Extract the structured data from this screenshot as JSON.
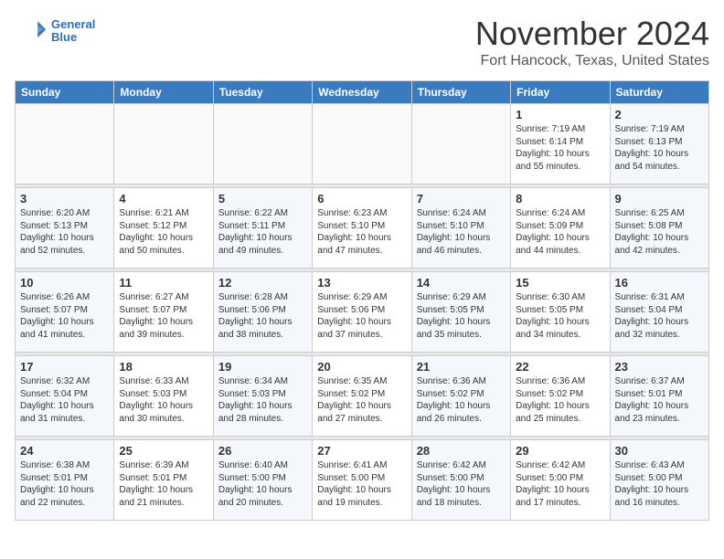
{
  "header": {
    "logo_line1": "General",
    "logo_line2": "Blue",
    "month": "November 2024",
    "location": "Fort Hancock, Texas, United States"
  },
  "weekdays": [
    "Sunday",
    "Monday",
    "Tuesday",
    "Wednesday",
    "Thursday",
    "Friday",
    "Saturday"
  ],
  "weeks": [
    [
      {
        "day": "",
        "text": ""
      },
      {
        "day": "",
        "text": ""
      },
      {
        "day": "",
        "text": ""
      },
      {
        "day": "",
        "text": ""
      },
      {
        "day": "",
        "text": ""
      },
      {
        "day": "1",
        "text": "Sunrise: 7:19 AM\nSunset: 6:14 PM\nDaylight: 10 hours and 55 minutes."
      },
      {
        "day": "2",
        "text": "Sunrise: 7:19 AM\nSunset: 6:13 PM\nDaylight: 10 hours and 54 minutes."
      }
    ],
    [
      {
        "day": "3",
        "text": "Sunrise: 6:20 AM\nSunset: 5:13 PM\nDaylight: 10 hours and 52 minutes."
      },
      {
        "day": "4",
        "text": "Sunrise: 6:21 AM\nSunset: 5:12 PM\nDaylight: 10 hours and 50 minutes."
      },
      {
        "day": "5",
        "text": "Sunrise: 6:22 AM\nSunset: 5:11 PM\nDaylight: 10 hours and 49 minutes."
      },
      {
        "day": "6",
        "text": "Sunrise: 6:23 AM\nSunset: 5:10 PM\nDaylight: 10 hours and 47 minutes."
      },
      {
        "day": "7",
        "text": "Sunrise: 6:24 AM\nSunset: 5:10 PM\nDaylight: 10 hours and 46 minutes."
      },
      {
        "day": "8",
        "text": "Sunrise: 6:24 AM\nSunset: 5:09 PM\nDaylight: 10 hours and 44 minutes."
      },
      {
        "day": "9",
        "text": "Sunrise: 6:25 AM\nSunset: 5:08 PM\nDaylight: 10 hours and 42 minutes."
      }
    ],
    [
      {
        "day": "10",
        "text": "Sunrise: 6:26 AM\nSunset: 5:07 PM\nDaylight: 10 hours and 41 minutes."
      },
      {
        "day": "11",
        "text": "Sunrise: 6:27 AM\nSunset: 5:07 PM\nDaylight: 10 hours and 39 minutes."
      },
      {
        "day": "12",
        "text": "Sunrise: 6:28 AM\nSunset: 5:06 PM\nDaylight: 10 hours and 38 minutes."
      },
      {
        "day": "13",
        "text": "Sunrise: 6:29 AM\nSunset: 5:06 PM\nDaylight: 10 hours and 37 minutes."
      },
      {
        "day": "14",
        "text": "Sunrise: 6:29 AM\nSunset: 5:05 PM\nDaylight: 10 hours and 35 minutes."
      },
      {
        "day": "15",
        "text": "Sunrise: 6:30 AM\nSunset: 5:05 PM\nDaylight: 10 hours and 34 minutes."
      },
      {
        "day": "16",
        "text": "Sunrise: 6:31 AM\nSunset: 5:04 PM\nDaylight: 10 hours and 32 minutes."
      }
    ],
    [
      {
        "day": "17",
        "text": "Sunrise: 6:32 AM\nSunset: 5:04 PM\nDaylight: 10 hours and 31 minutes."
      },
      {
        "day": "18",
        "text": "Sunrise: 6:33 AM\nSunset: 5:03 PM\nDaylight: 10 hours and 30 minutes."
      },
      {
        "day": "19",
        "text": "Sunrise: 6:34 AM\nSunset: 5:03 PM\nDaylight: 10 hours and 28 minutes."
      },
      {
        "day": "20",
        "text": "Sunrise: 6:35 AM\nSunset: 5:02 PM\nDaylight: 10 hours and 27 minutes."
      },
      {
        "day": "21",
        "text": "Sunrise: 6:36 AM\nSunset: 5:02 PM\nDaylight: 10 hours and 26 minutes."
      },
      {
        "day": "22",
        "text": "Sunrise: 6:36 AM\nSunset: 5:02 PM\nDaylight: 10 hours and 25 minutes."
      },
      {
        "day": "23",
        "text": "Sunrise: 6:37 AM\nSunset: 5:01 PM\nDaylight: 10 hours and 23 minutes."
      }
    ],
    [
      {
        "day": "24",
        "text": "Sunrise: 6:38 AM\nSunset: 5:01 PM\nDaylight: 10 hours and 22 minutes."
      },
      {
        "day": "25",
        "text": "Sunrise: 6:39 AM\nSunset: 5:01 PM\nDaylight: 10 hours and 21 minutes."
      },
      {
        "day": "26",
        "text": "Sunrise: 6:40 AM\nSunset: 5:00 PM\nDaylight: 10 hours and 20 minutes."
      },
      {
        "day": "27",
        "text": "Sunrise: 6:41 AM\nSunset: 5:00 PM\nDaylight: 10 hours and 19 minutes."
      },
      {
        "day": "28",
        "text": "Sunrise: 6:42 AM\nSunset: 5:00 PM\nDaylight: 10 hours and 18 minutes."
      },
      {
        "day": "29",
        "text": "Sunrise: 6:42 AM\nSunset: 5:00 PM\nDaylight: 10 hours and 17 minutes."
      },
      {
        "day": "30",
        "text": "Sunrise: 6:43 AM\nSunset: 5:00 PM\nDaylight: 10 hours and 16 minutes."
      }
    ]
  ]
}
